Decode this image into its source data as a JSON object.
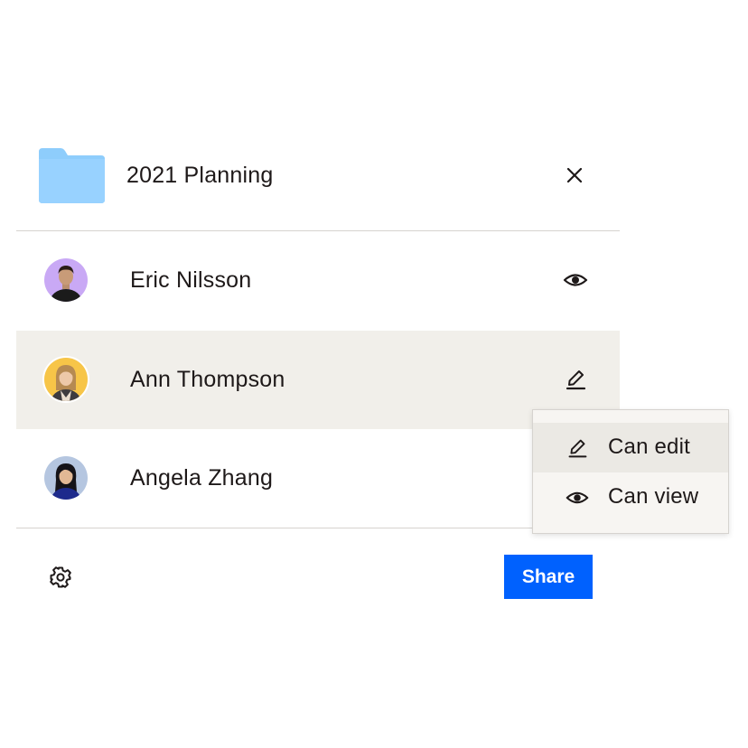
{
  "folder": {
    "name": "2021 Planning",
    "icon": "folder-icon",
    "color": "#8ecdfc"
  },
  "members": [
    {
      "name": "Eric Nilsson",
      "avatar_color": "#c9a9f5",
      "permission_icon": "eye-icon"
    },
    {
      "name": "Ann Thompson",
      "avatar_color": "#f7c548",
      "permission_icon": "pencil-icon",
      "highlighted": true
    },
    {
      "name": "Angela Zhang",
      "avatar_color": "#b5c6e0",
      "permission_icon": "none"
    }
  ],
  "permission_menu": {
    "items": [
      {
        "label": "Can edit",
        "icon": "pencil-icon",
        "active": true
      },
      {
        "label": "Can view",
        "icon": "eye-icon",
        "active": false
      }
    ]
  },
  "footer": {
    "settings_icon": "gear-icon",
    "share_label": "Share",
    "share_color": "#0061fe"
  },
  "colors": {
    "highlight_row": "#f1efea",
    "divider": "#d6d3cf",
    "text": "#1e1919"
  }
}
